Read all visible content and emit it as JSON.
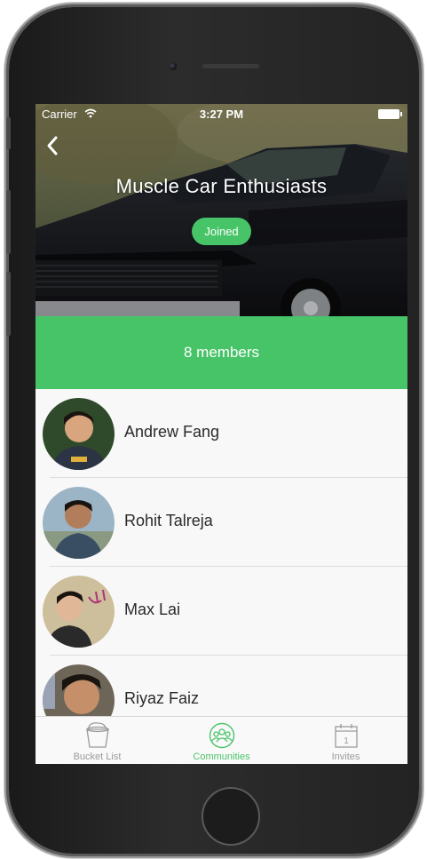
{
  "status_bar": {
    "carrier": "Carrier",
    "time": "3:27 PM"
  },
  "header": {
    "title": "Muscle Car Enthusiasts",
    "joined_label": "Joined"
  },
  "members_summary": "8 members",
  "members": [
    {
      "name": "Andrew Fang"
    },
    {
      "name": "Rohit Talreja"
    },
    {
      "name": "Max Lai"
    },
    {
      "name": "Riyaz Faiz"
    }
  ],
  "tabs": [
    {
      "label": "Bucket List",
      "icon": "bucket-icon",
      "active": false
    },
    {
      "label": "Communities",
      "icon": "people-circle-icon",
      "active": true
    },
    {
      "label": "Invites",
      "icon": "calendar-icon",
      "active": false,
      "icon_text": "1"
    }
  ],
  "colors": {
    "accent": "#47c468",
    "text": "#2a2a2a",
    "tab_inactive": "#9a9a9a"
  }
}
